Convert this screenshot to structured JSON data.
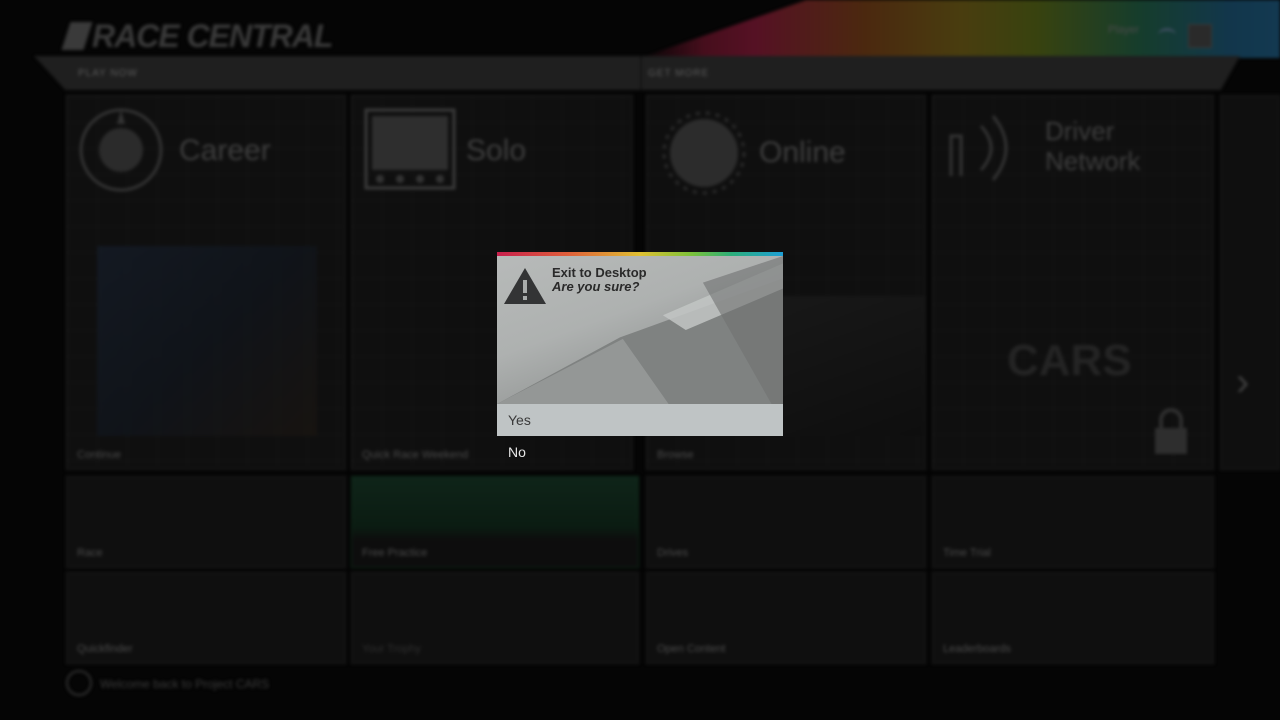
{
  "app": {
    "logo_text": "RACE CENTRAL"
  },
  "top_bar": {
    "status_text": "Player",
    "tab_left": "PLAY NOW",
    "tab_right": "GET MORE"
  },
  "tiles": {
    "career": {
      "title": "Career",
      "caption": "Continue"
    },
    "solo": {
      "title": "Solo",
      "caption": "Quick Race Weekend"
    },
    "online": {
      "title": "Online",
      "caption": "Browse"
    },
    "driver_network": {
      "title": "Driver Network"
    },
    "cars": {
      "text": "CARS"
    },
    "row2": [
      "Race",
      "Free Practice",
      "Drives",
      "Time Trial"
    ],
    "row3": [
      "Quickfinder",
      "Your Trophy",
      "Open Content",
      "Leaderboards"
    ]
  },
  "footer": {
    "message": "Welcome back to Project CARS"
  },
  "dialog": {
    "title": "Exit to Desktop",
    "subtitle": "Are you sure?",
    "options": {
      "yes": "Yes",
      "no": "No"
    },
    "icon": "warning-icon",
    "accent_colors": [
      "#c8204d",
      "#e0c032",
      "#2cae7a",
      "#1d9fd6"
    ],
    "selected_option": "Yes"
  }
}
